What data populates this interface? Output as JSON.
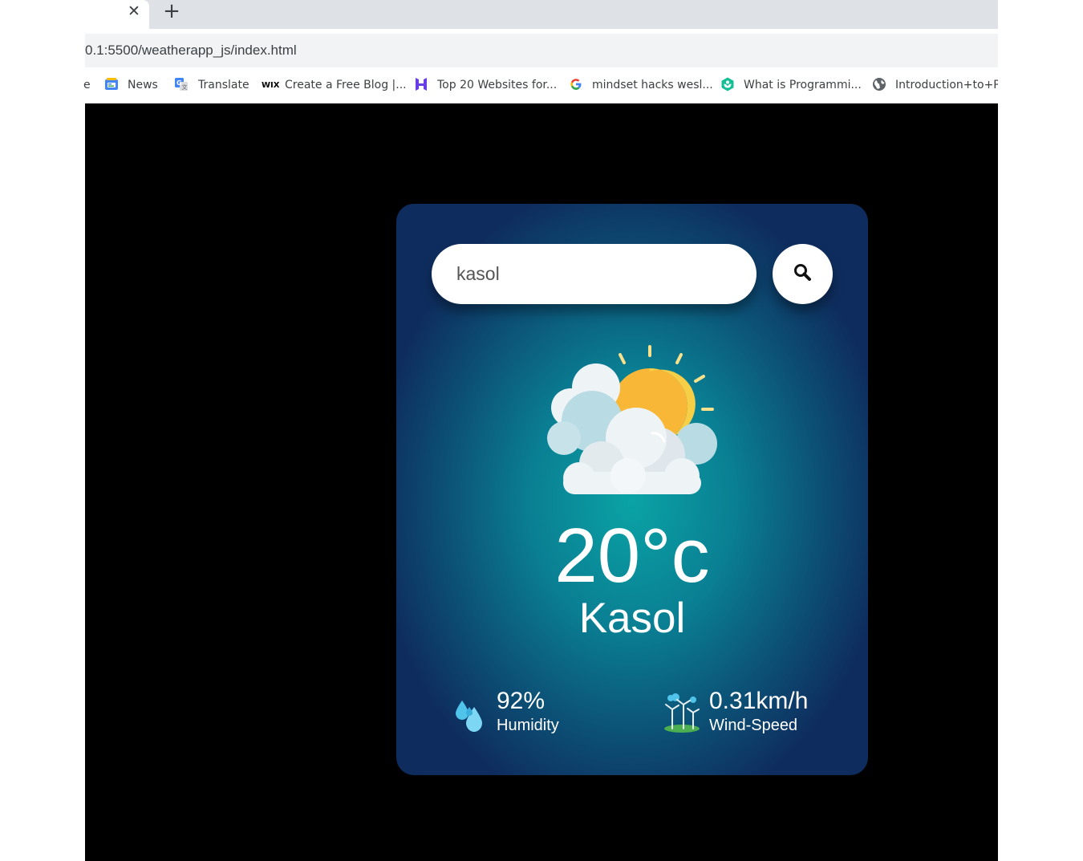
{
  "browser": {
    "tab_close_glyph": "✕",
    "new_tab_glyph": "+",
    "url": "0.1:5500/weatherapp_js/index.html",
    "bookmarks": [
      {
        "label": "e",
        "icon": "truncated-bookmark"
      },
      {
        "label": "News",
        "icon": "google-news-icon"
      },
      {
        "label": "Translate",
        "icon": "google-translate-icon"
      },
      {
        "label": "Create a Free Blog |...",
        "icon": "wix-icon"
      },
      {
        "label": "Top 20 Websites for...",
        "icon": "hostinger-icon"
      },
      {
        "label": "mindset hacks wesl...",
        "icon": "google-icon"
      },
      {
        "label": "What is Programmi...",
        "icon": "khan-academy-icon"
      },
      {
        "label": "Introduction+to+Pr",
        "icon": "globe-icon"
      }
    ]
  },
  "weather": {
    "search": {
      "value": "kasol",
      "placeholder": "",
      "button_icon": "search-icon"
    },
    "condition_icon": "sun-behind-clouds-icon",
    "temperature": "20°c",
    "city": "Kasol",
    "humidity": {
      "value": "92%",
      "label": "Humidity",
      "icon": "water-drops-icon"
    },
    "wind": {
      "value": "0.31km/h",
      "label": "Wind-Speed",
      "icon": "wind-turbines-icon"
    }
  },
  "colors": {
    "page_background": "#000000",
    "card_center": "#0aa3a5",
    "card_edge": "#0e2d5e",
    "text": "#ffffff",
    "sun": "#f8b737",
    "sun_rays": "#f9e08a",
    "cloud": "#eef3f6",
    "cloud_shadow": "#b9dce4",
    "drop": "#4fc3ea"
  }
}
